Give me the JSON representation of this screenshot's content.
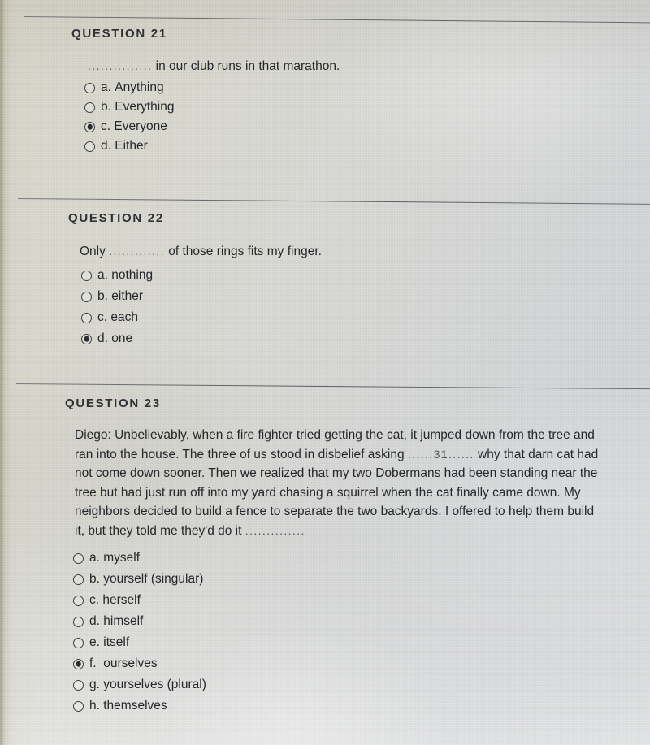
{
  "document": {
    "type": "multiple-choice-quiz",
    "background_color": "#d6d6d3",
    "text_color": "#26272b"
  },
  "questions": [
    {
      "heading": "QUESTION 21",
      "stem_blank": "...............",
      "stem_text": "in our club runs in that marathon.",
      "options": [
        {
          "letter": "a.",
          "text": "Anything",
          "selected": false
        },
        {
          "letter": "b.",
          "text": "Everything",
          "selected": false
        },
        {
          "letter": "c.",
          "text": "Everyone",
          "selected": true
        },
        {
          "letter": "d.",
          "text": "Either",
          "selected": false
        }
      ]
    },
    {
      "heading": "QUESTION 22",
      "stem_prefix": "Only",
      "stem_blank": ".............",
      "stem_text": "of those rings fits my finger.",
      "options": [
        {
          "letter": "a.",
          "text": "nothing",
          "selected": false
        },
        {
          "letter": "b.",
          "text": "either",
          "selected": false
        },
        {
          "letter": "c.",
          "text": "each",
          "selected": false
        },
        {
          "letter": "d.",
          "text": "one",
          "selected": true
        }
      ]
    },
    {
      "heading": "QUESTION 23",
      "passage_line_1": "Diego: Unbelievably, when a fire fighter tried getting the cat, it jumped down from",
      "passage_line_2": "the tree and ran into the house. The three of us stood in disbelief asking",
      "passage_line_3_blank": "......31......",
      "passage_line_3": "why that darn cat had not come down sooner. Then we realized",
      "passage_line_4": "that my two Dobermans had been standing near the tree but had just run off",
      "passage_line_5": "into my yard chasing a squirrel when the cat finally came down. My neighbors",
      "passage_line_6": "decided to build a fence to separate the two backyards. I offered to help them",
      "passage_line_7": "build it, but they told me they'd do it",
      "passage_line_7_blank": "..............",
      "options": [
        {
          "letter": "a.",
          "text": "myself",
          "selected": false
        },
        {
          "letter": "b.",
          "text": "yourself (singular)",
          "selected": false
        },
        {
          "letter": "c.",
          "text": "herself",
          "selected": false
        },
        {
          "letter": "d.",
          "text": "himself",
          "selected": false
        },
        {
          "letter": "e.",
          "text": "itself",
          "selected": false
        },
        {
          "letter": "f.",
          "text": "ourselves",
          "selected": true
        },
        {
          "letter": "g.",
          "text": "yourselves (plural)",
          "selected": false
        },
        {
          "letter": "h.",
          "text": "themselves",
          "selected": false
        }
      ]
    }
  ]
}
